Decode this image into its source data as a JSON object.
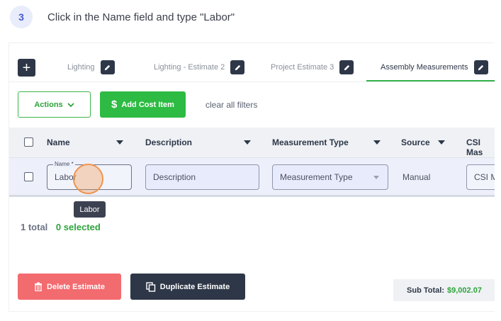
{
  "step": {
    "number": "3",
    "instruction": "Click in the Name field and type \"Labor\""
  },
  "tabs": [
    {
      "label": "Lighting"
    },
    {
      "label": "Lighting - Estimate 2"
    },
    {
      "label": "Project Estimate 3"
    },
    {
      "label": "Assembly Measurements"
    }
  ],
  "toolbar": {
    "actions_label": "Actions",
    "add_cost_item_label": "Add Cost Item",
    "clear_filters_label": "clear all filters"
  },
  "table": {
    "columns": [
      "Name",
      "Description",
      "Measurement Type",
      "Source",
      "CSI Mas"
    ],
    "row": {
      "name_legend": "Name *",
      "name_value": "Labor",
      "description_placeholder": "Description",
      "measurement_type_placeholder": "Measurement Type",
      "source": "Manual",
      "csi_placeholder": "CSI Ma"
    }
  },
  "tooltip": "Labor",
  "summary": {
    "total": "1 total",
    "selected": "0 selected"
  },
  "footer": {
    "delete_label": "Delete Estimate",
    "duplicate_label": "Duplicate Estimate",
    "subtotal_label": "Sub Total:",
    "subtotal_value": "$9,002.07"
  },
  "colors": {
    "accent_green": "#2dbb43",
    "danger_red": "#f26b6f",
    "dark": "#2e3747",
    "highlight_orange": "#f0944e"
  }
}
